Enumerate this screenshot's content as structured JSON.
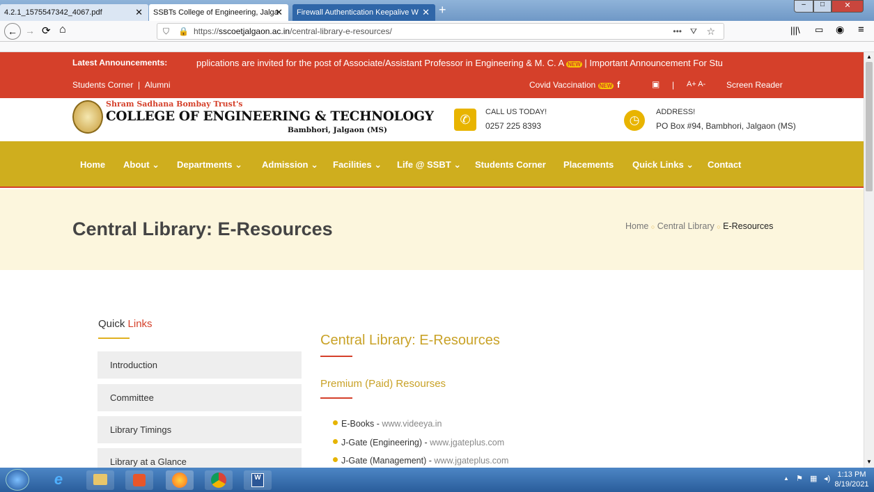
{
  "tabs": [
    {
      "label": "4.2.1_1575547342_4067.pdf",
      "active": false
    },
    {
      "label": "SSBTs College of Engineering, Jalga",
      "active": true
    },
    {
      "label": "Firewall Authentication Keepalive W",
      "active": false
    }
  ],
  "url": {
    "prefix": "https://",
    "domain": "sscoetjalgaon.ac.in",
    "path": "/central-library-e-resources/"
  },
  "topbar": {
    "announce_label": "Latest Announcements:",
    "announce_text": "pplications are invited for the post of Associate/Assistant Professor in Engineering & M. C. A",
    "announce_text2": "| Important Announcement For Stu",
    "students_corner": "Students Corner",
    "alumni": "Alumni",
    "covid": "Covid Vaccination",
    "font_sizes": "A+ A-",
    "screen_reader": "Screen Reader",
    "new_badge": "NEW"
  },
  "logo": {
    "trust": "Shram Sadhana Bombay Trust's",
    "college": "COLLEGE OF ENGINEERING & TECHNOLOGY",
    "place": "Bambhori, Jalgaon (MS)"
  },
  "contact": {
    "call_label": "CALL US TODAY!",
    "phone": "0257 225 8393",
    "address_label": "ADDRESS!",
    "address": "PO Box #94, Bambhori, Jalgaon (MS)"
  },
  "menu": [
    "Home",
    "About ⌄",
    "Departments ⌄",
    "Admission ⌄",
    "Facilities ⌄",
    "Life @ SSBT ⌄",
    "Students Corner",
    "Placements",
    "Quick Links ⌄",
    "Contact"
  ],
  "page_title": "Central Library: E-Resources",
  "breadcrumb": [
    "Home",
    "Central Library",
    "E-Resources"
  ],
  "sidebar": {
    "heading_a": "Quick",
    "heading_b": "Links",
    "items": [
      "Introduction",
      "Committee",
      "Library Timings",
      "Library at a Glance"
    ]
  },
  "content": {
    "heading": "Central Library: E-Resources",
    "subheading": "Premium (Paid) Resourses",
    "items": [
      {
        "name": "E-Books",
        "url": "www.videeya.in"
      },
      {
        "name": "J-Gate (Engineering)",
        "url": "www.jgateplus.com"
      },
      {
        "name": "J-Gate (Management)",
        "url": "www.jgateplus.com"
      }
    ]
  },
  "clock": {
    "time": "1:13 PM",
    "date": "8/19/2021"
  },
  "colors": {
    "red": "#d5402a",
    "gold": "#cfae1e",
    "cream": "#fcf6dd"
  }
}
